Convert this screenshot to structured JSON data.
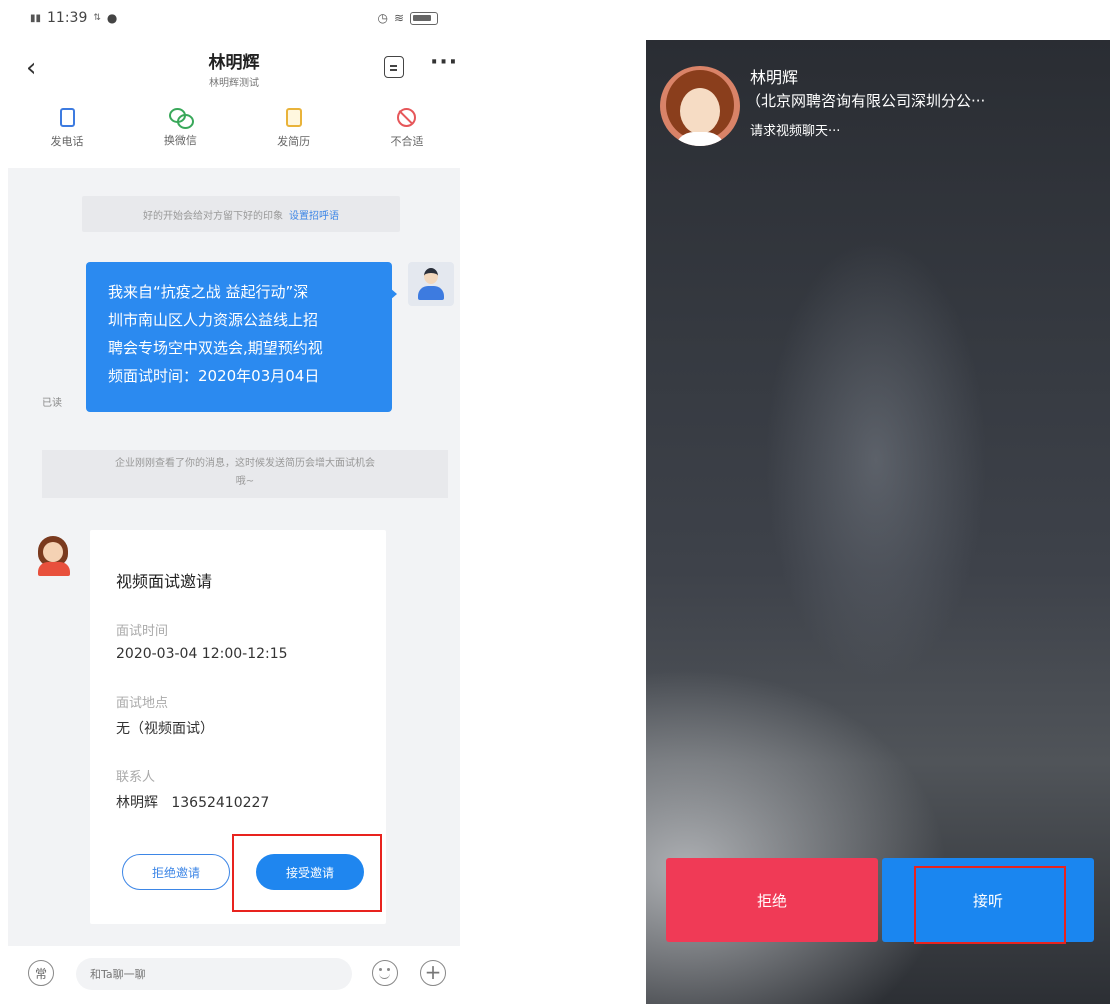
{
  "left_screen": {
    "status_bar": {
      "time": "11:39",
      "signal_text": "᪲"
    },
    "nav": {
      "title": "林明辉",
      "subtitle": "林明辉测试"
    },
    "actions": [
      {
        "label": "发电话",
        "icon": "phone-icon",
        "color": "#3d7be0"
      },
      {
        "label": "换微信",
        "icon": "wechat-icon",
        "color": "#39a85a"
      },
      {
        "label": "发简历",
        "icon": "resume-icon",
        "color": "#e9b33a"
      },
      {
        "label": "不合适",
        "icon": "unfit-icon",
        "color": "#e6575a"
      }
    ],
    "tip_top": {
      "text": "好的开始会给对方留下好的印象",
      "link": "设置招呼语"
    },
    "my_message": {
      "lines": [
        "我来自“抗疫之战 益起行动”深",
        "圳市南山区人力资源公益线上招",
        "聘会专场空中双选会,期望预约视",
        "频面试时间：2020年03月04日"
      ],
      "read_status": "已读"
    },
    "tip_mid": {
      "line1": "企业刚刚查看了你的消息，这时候发送简历会增大面试机会",
      "line2": "哦~"
    },
    "invite_card": {
      "title": "视频面试邀请",
      "time_label": "面试时间",
      "time_value": "2020-03-04 12:00-12:15",
      "place_label": "面试地点",
      "place_value": "无（视频面试）",
      "contact_label": "联系人",
      "contact_value": "林明辉   13652410227",
      "reject_label": "拒绝邀请",
      "accept_label": "接受邀请"
    },
    "input_bar": {
      "common_label": "常",
      "placeholder": "和Ta聊一聊"
    }
  },
  "right_screen": {
    "caller_name": "林明辉",
    "caller_company": "（北京网聘咨询有限公司深圳分公···",
    "call_status": "请求视频聊天···",
    "reject_label": "拒绝",
    "answer_label": "接听"
  },
  "colors": {
    "accent_blue": "#1f86ef",
    "reject_red": "#f03a56",
    "highlight_red": "#e8231e"
  }
}
